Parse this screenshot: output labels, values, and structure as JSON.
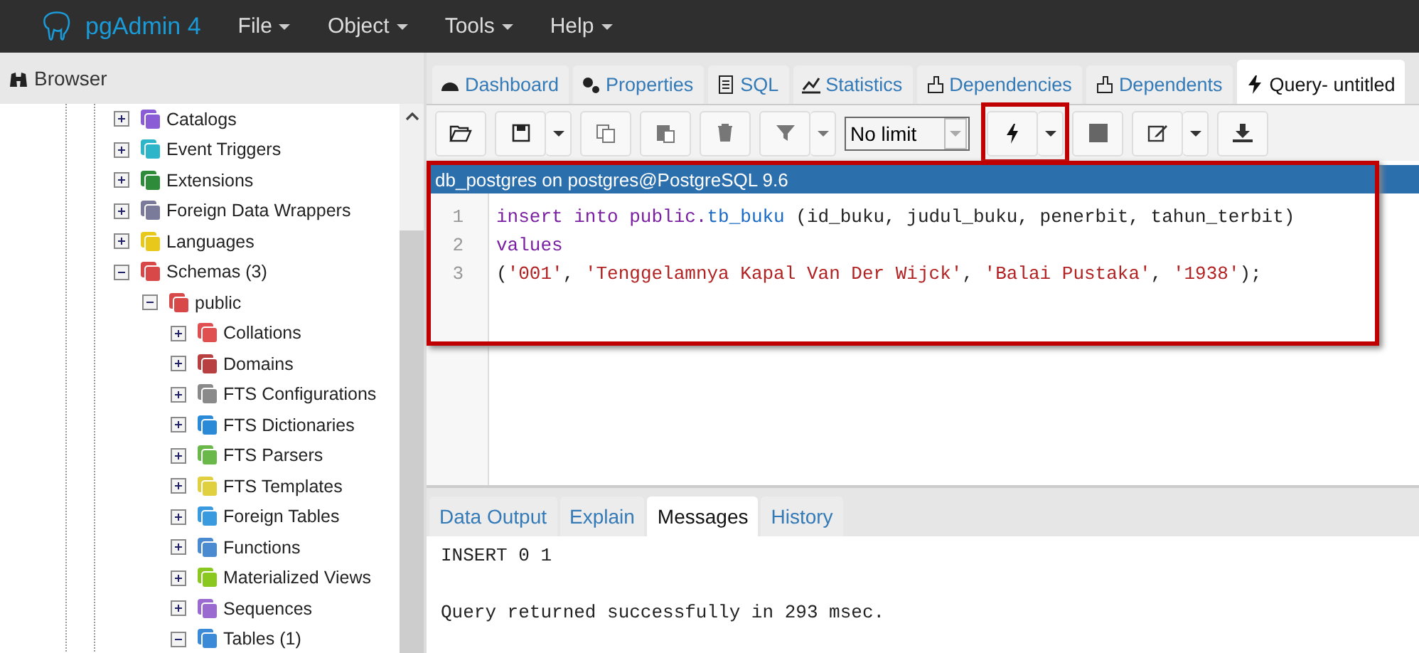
{
  "app": {
    "title": "pgAdmin 4",
    "menus": [
      "File",
      "Object",
      "Tools",
      "Help"
    ]
  },
  "browser": {
    "title": "Browser",
    "tree": [
      {
        "label": "Catalogs",
        "expanded": false,
        "color": "#8a5cd6"
      },
      {
        "label": "Event Triggers",
        "expanded": false,
        "color": "#2fb5c9"
      },
      {
        "label": "Extensions",
        "expanded": false,
        "color": "#2e8b3a"
      },
      {
        "label": "Foreign Data Wrappers",
        "expanded": false,
        "color": "#7a7a9a"
      },
      {
        "label": "Languages",
        "expanded": false,
        "color": "#e8c81a"
      },
      {
        "label": "Schemas (3)",
        "expanded": true,
        "color": "#d84848",
        "children": [
          {
            "label": "public",
            "expanded": true,
            "color": "#d84848",
            "children": [
              {
                "label": "Collations",
                "expanded": false,
                "color": "#e05050"
              },
              {
                "label": "Domains",
                "expanded": false,
                "color": "#b84040"
              },
              {
                "label": "FTS Configurations",
                "expanded": false,
                "color": "#8a8a8a"
              },
              {
                "label": "FTS Dictionaries",
                "expanded": false,
                "color": "#2a8ad8"
              },
              {
                "label": "FTS Parsers",
                "expanded": false,
                "color": "#6ab84a"
              },
              {
                "label": "FTS Templates",
                "expanded": false,
                "color": "#e0d040"
              },
              {
                "label": "Foreign Tables",
                "expanded": false,
                "color": "#3a9ae0"
              },
              {
                "label": "Functions",
                "expanded": false,
                "color": "#4a8ad0"
              },
              {
                "label": "Materialized Views",
                "expanded": false,
                "color": "#8ac820"
              },
              {
                "label": "Sequences",
                "expanded": false,
                "color": "#9a6ad0"
              },
              {
                "label": "Tables (1)",
                "expanded": true,
                "color": "#3a8ad8"
              }
            ]
          }
        ]
      }
    ]
  },
  "panel_tabs": [
    {
      "label": "Dashboard",
      "selected": false
    },
    {
      "label": "Properties",
      "selected": false
    },
    {
      "label": "SQL",
      "selected": false
    },
    {
      "label": "Statistics",
      "selected": false
    },
    {
      "label": "Dependencies",
      "selected": false
    },
    {
      "label": "Dependents",
      "selected": false
    },
    {
      "label": "Query- untitled",
      "selected": true
    }
  ],
  "toolbar": {
    "row_limit": "No limit",
    "execute_highlighted": true
  },
  "editor": {
    "connection": "db_postgres on postgres@PostgreSQL 9.6",
    "highlighted": true,
    "lines": [
      {
        "number": "1",
        "tokens": [
          {
            "kind": "keyword",
            "text": "insert into public."
          },
          {
            "kind": "name",
            "text": "tb_buku"
          },
          {
            "kind": "plain",
            "text": " (id_buku, judul_buku, penerbit, tahun_terbit)"
          }
        ]
      },
      {
        "number": "2",
        "tokens": [
          {
            "kind": "keyword",
            "text": "values"
          }
        ]
      },
      {
        "number": "3",
        "tokens": [
          {
            "kind": "plain",
            "text": "("
          },
          {
            "kind": "string",
            "text": "'001'"
          },
          {
            "kind": "plain",
            "text": ", "
          },
          {
            "kind": "string",
            "text": "'Tenggelamnya Kapal Van Der Wijck'"
          },
          {
            "kind": "plain",
            "text": ", "
          },
          {
            "kind": "string",
            "text": "'Balai Pustaka'"
          },
          {
            "kind": "plain",
            "text": ", "
          },
          {
            "kind": "string",
            "text": "'1938'"
          },
          {
            "kind": "plain",
            "text": ");"
          }
        ]
      }
    ]
  },
  "results": {
    "tabs": [
      {
        "label": "Data Output",
        "selected": false
      },
      {
        "label": "Explain",
        "selected": false
      },
      {
        "label": "Messages",
        "selected": true
      },
      {
        "label": "History",
        "selected": false
      }
    ],
    "messages": [
      "INSERT 0 1",
      "Query returned successfully in 293 msec."
    ]
  }
}
